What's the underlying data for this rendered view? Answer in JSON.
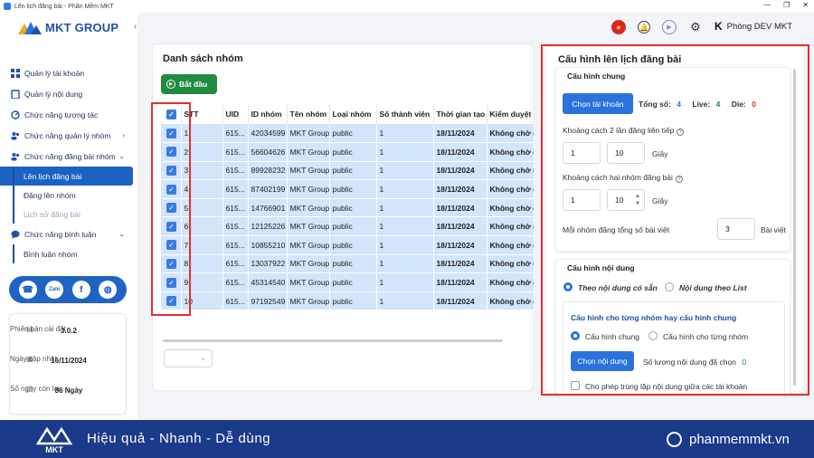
{
  "window": {
    "title": "Lên lịch đăng bài - Phần Mềm MKT"
  },
  "brand": {
    "logo_text": "MKT GROUP"
  },
  "sidebar": {
    "items": [
      {
        "label": "Quản lý tài khoản"
      },
      {
        "label": "Quản lý nội dung"
      },
      {
        "label": "Chức năng tương tác"
      },
      {
        "label": "Chức năng quản lý nhóm"
      },
      {
        "label": "Chức năng đăng bài nhóm"
      },
      {
        "label": "Chức năng bình luận"
      }
    ],
    "sub_post": [
      {
        "label": "Lên lịch đăng bài"
      },
      {
        "label": "Đăng lên nhóm"
      },
      {
        "label": "Lịch sử đăng bài"
      }
    ],
    "sub_comment": [
      {
        "label": "Bình luận nhóm"
      }
    ],
    "social": {
      "zalo": "Zalo",
      "facebook": "f"
    }
  },
  "info": {
    "version_label": "Phiên bản cài đặt",
    "version": "3.0.2",
    "update_label": "Ngày cập nhật",
    "update": "16/11/2024",
    "days_label": "Số ngày còn lại",
    "days": "86 Ngày"
  },
  "header": {
    "user": "Phòng DEV MKT",
    "user_logo": "K"
  },
  "groups": {
    "title": "Danh sách nhóm",
    "start_button": "Bắt đầu",
    "columns": [
      "STT",
      "UID",
      "ID nhóm",
      "Tên nhóm",
      "Loại nhóm",
      "Số thành viên",
      "Thời gian tạo",
      "Kiểm duyệt"
    ],
    "rows": [
      [
        "1",
        "615...",
        "42034599",
        "MKT Group",
        "public",
        "1",
        "18/11/2024",
        "Không chờ d"
      ],
      [
        "2",
        "615...",
        "56604626",
        "MKT Group",
        "public",
        "1",
        "18/11/2024",
        "Không chờ d"
      ],
      [
        "3",
        "615...",
        "89928232",
        "MKT Group",
        "public",
        "1",
        "18/11/2024",
        "Không chờ d"
      ],
      [
        "4",
        "615...",
        "87402199",
        "MKT Group",
        "public",
        "1",
        "18/11/2024",
        "Không chờ d"
      ],
      [
        "5",
        "615...",
        "14766901",
        "MKT Group",
        "public",
        "1",
        "18/11/2024",
        "Không chờ d"
      ],
      [
        "6",
        "615...",
        "12125226",
        "MKT Group",
        "public",
        "1",
        "18/11/2024",
        "Không chờ d"
      ],
      [
        "7",
        "615...",
        "10855210",
        "MKT Group",
        "public",
        "1",
        "18/11/2024",
        "Không chờ d"
      ],
      [
        "8",
        "615...",
        "13037922",
        "MKT Group",
        "public",
        "1",
        "18/11/2024",
        "Không chờ d"
      ],
      [
        "9",
        "615...",
        "45314540",
        "MKT Group",
        "public",
        "1",
        "18/11/2024",
        "Không chờ d"
      ],
      [
        "10",
        "615...",
        "97192549",
        "MKT Group",
        "public",
        "1",
        "18/11/2024",
        "Không chờ d"
      ]
    ]
  },
  "config": {
    "title": "Cấu hình lên lịch đăng bài",
    "general": {
      "title": "Cấu hình chung",
      "select_button": "Chọn tài khoản",
      "total_label": "Tổng số:",
      "total": "4",
      "live_label": "Live:",
      "live": "4",
      "die_label": "Die:",
      "die": "0",
      "gap_label": "Khoảng cách 2 lần đăng liên tiếp",
      "gap_from": "1",
      "gap_to": "10",
      "gap_unit": "Giây",
      "group_gap_label": "Khoảng cách hai nhóm đăng bài",
      "group_gap_from": "1",
      "group_gap_to": "10",
      "group_gap_unit": "Giây",
      "per_group_label": "Mỗi nhóm đăng tổng số bài viết",
      "per_group": "3",
      "per_group_unit": "Bài viết"
    },
    "content": {
      "title": "Cấu hình nội dung",
      "opt_available": "Theo nội dung có sẵn",
      "opt_list": "Nội dung theo List",
      "sub_title": "Cấu hình cho từng nhóm hay cấu hình chung",
      "opt_general": "Cấu hình chung",
      "opt_each": "Cấu hình cho từng nhóm",
      "select_button": "Chọn nội dung",
      "count_label": "Số lượng nội dung đã chọn",
      "count": "0",
      "dup_label": "Cho phép trùng lặp nội dung giữa các tài khoản"
    }
  },
  "footer": {
    "tagline": "Hiệu quả - Nhanh - Dễ dùng",
    "site": "phanmemmkt.vn",
    "logo_text": "MKT"
  },
  "colors": {
    "primary": "#2b72dd",
    "start_green": "#1f8b3e",
    "highlight_red": "#e12f2f",
    "footer": "#1c3a8a",
    "row_selected": "#d3e5fb"
  }
}
